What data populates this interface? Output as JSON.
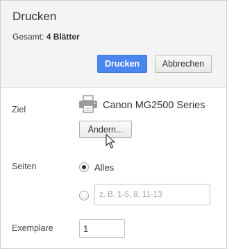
{
  "dialog": {
    "title": "Drucken",
    "total_label": "Gesamt:",
    "total_value": "4 Blätter"
  },
  "buttons": {
    "print_label": "Drucken",
    "cancel_label": "Abbrechen",
    "change_label": "Ändern..."
  },
  "destination": {
    "label": "Ziel",
    "printer_name": "Canon MG2500 Series",
    "icon": "printer-icon"
  },
  "pages": {
    "label": "Seiten",
    "option_all_label": "Alles",
    "option_all_selected": true,
    "option_custom_selected": false,
    "custom_placeholder": "z. B. 1-5, 8, 11-13",
    "custom_value": ""
  },
  "copies": {
    "label": "Exemplare",
    "value": "1"
  },
  "colors": {
    "accent": "#4a86ee",
    "header_bg": "#f4f4f4"
  }
}
